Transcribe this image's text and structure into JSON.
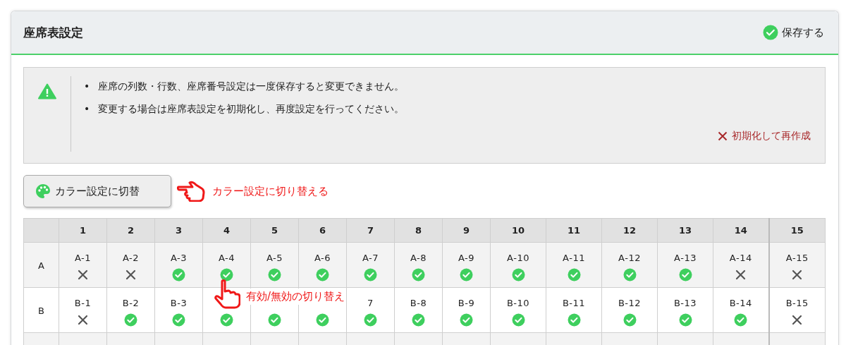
{
  "panel": {
    "title": "座席表設定",
    "save_button": "保存する"
  },
  "notice": {
    "bullets": [
      {
        "marker": "•",
        "text": "座席の列数・行数、座席番号設定は一度保存すると変更できません。"
      },
      {
        "marker": "•",
        "text": "変更する場合は座席表設定を初期化し、再度設定を行ってください。"
      }
    ],
    "reset_link": "初期化して再作成"
  },
  "color_toggle": {
    "button": "カラー設定に切替",
    "callout": "カラー設定に切り替える"
  },
  "toggle_callout": "有効/無効の切り替え",
  "table": {
    "columns": [
      "1",
      "2",
      "3",
      "4",
      "5",
      "6",
      "7",
      "8",
      "9",
      "10",
      "11",
      "12",
      "13",
      "14",
      "15"
    ],
    "rows": [
      {
        "label": "A",
        "seats": [
          {
            "label": "A-1",
            "enabled": false
          },
          {
            "label": "A-2",
            "enabled": false
          },
          {
            "label": "A-3",
            "enabled": true
          },
          {
            "label": "A-4",
            "enabled": true
          },
          {
            "label": "A-5",
            "enabled": true
          },
          {
            "label": "A-6",
            "enabled": true
          },
          {
            "label": "A-7",
            "enabled": true
          },
          {
            "label": "A-8",
            "enabled": true
          },
          {
            "label": "A-9",
            "enabled": true
          },
          {
            "label": "A-10",
            "enabled": true
          },
          {
            "label": "A-11",
            "enabled": true
          },
          {
            "label": "A-12",
            "enabled": true
          },
          {
            "label": "A-13",
            "enabled": true
          },
          {
            "label": "A-14",
            "enabled": false
          },
          {
            "label": "A-15",
            "enabled": false
          }
        ]
      },
      {
        "label": "B",
        "seats": [
          {
            "label": "B-1",
            "enabled": false
          },
          {
            "label": "B-2",
            "enabled": true
          },
          {
            "label": "B-3",
            "enabled": true
          },
          {
            "enabled": true
          },
          {
            "enabled": true
          },
          {
            "enabled": true
          },
          {
            "label": "7",
            "enabled": true
          },
          {
            "label": "B-8",
            "enabled": true
          },
          {
            "label": "B-9",
            "enabled": true
          },
          {
            "label": "B-10",
            "enabled": true
          },
          {
            "label": "B-11",
            "enabled": true
          },
          {
            "label": "B-12",
            "enabled": true
          },
          {
            "label": "B-13",
            "enabled": true
          },
          {
            "label": "B-14",
            "enabled": true
          },
          {
            "label": "B-15",
            "enabled": false
          }
        ]
      }
    ]
  }
}
